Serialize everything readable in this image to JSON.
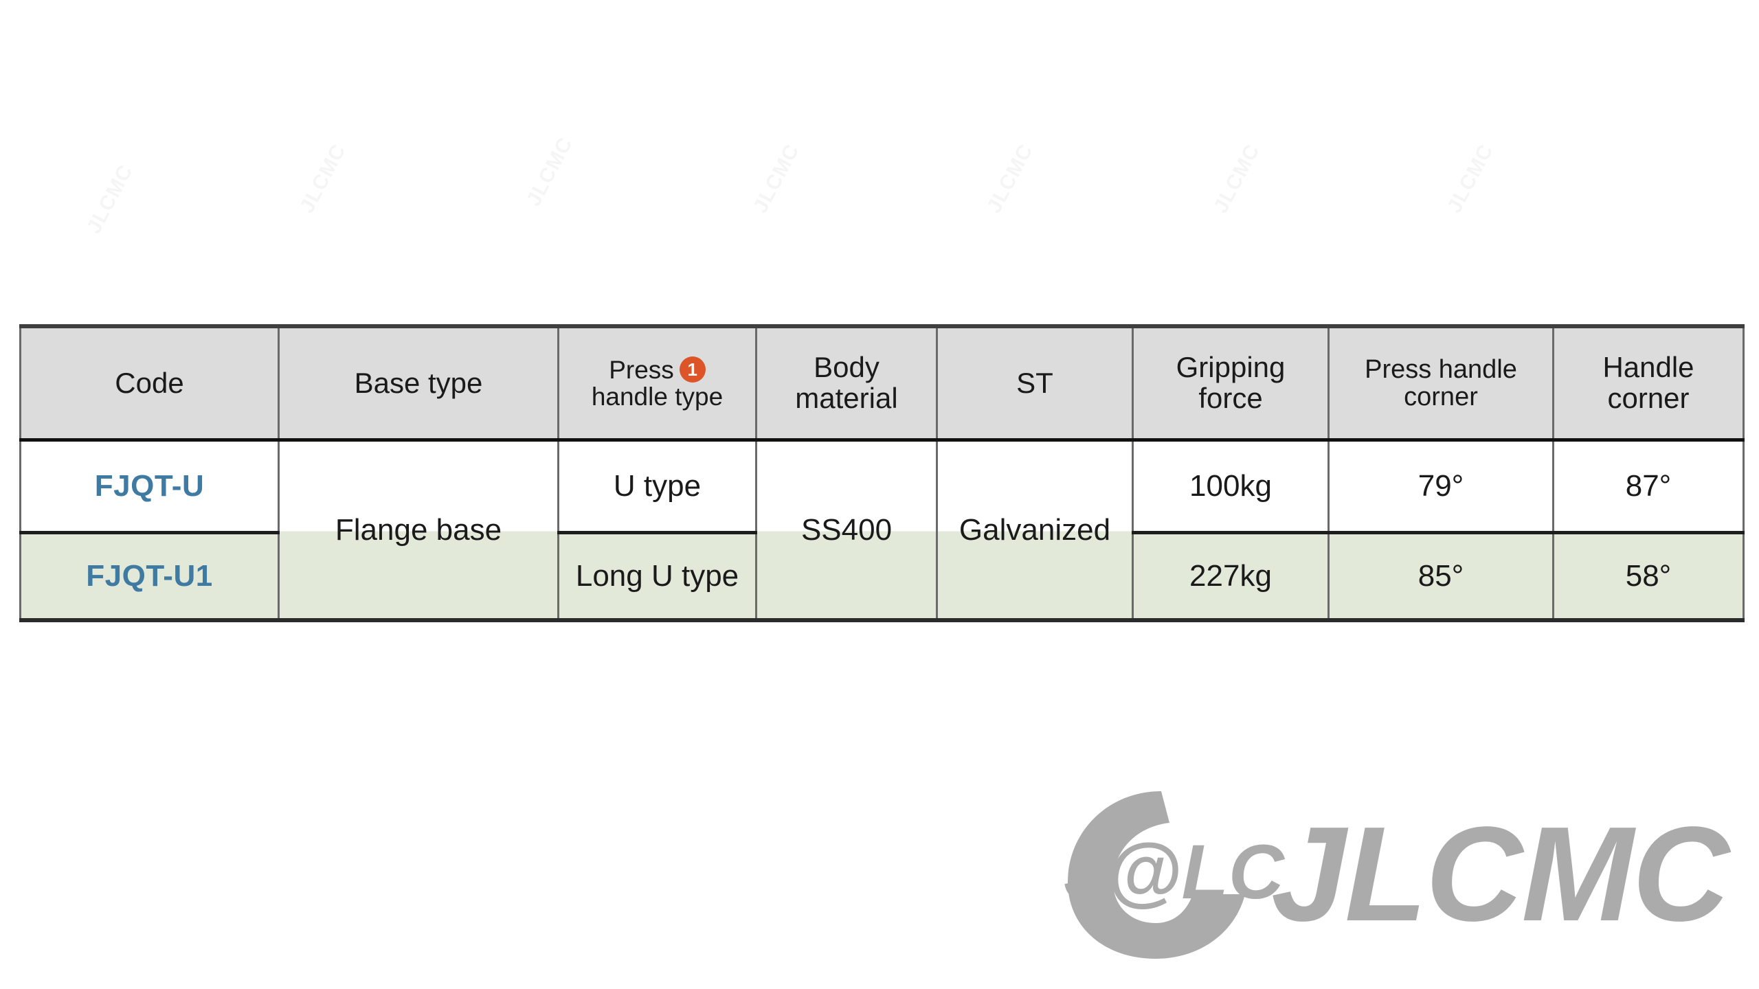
{
  "table": {
    "columns": [
      {
        "id": "code",
        "label": "Code"
      },
      {
        "id": "base_type",
        "label": "Base type"
      },
      {
        "id": "press_handle_type",
        "label_line1": "Press",
        "label_line2": "handle type",
        "note": "1",
        "note_color": "#dc5428"
      },
      {
        "id": "body_material",
        "label_line1": "Body",
        "label_line2": "material"
      },
      {
        "id": "st",
        "label": "ST"
      },
      {
        "id": "gripping_force",
        "label_line1": "Gripping",
        "label_line2": "force"
      },
      {
        "id": "press_handle_corner",
        "label_line1": "Press handle",
        "label_line2": "corner"
      },
      {
        "id": "handle_corner",
        "label_line1": "Handle",
        "label_line2": "corner"
      }
    ],
    "merged": {
      "base_type": "Flange base",
      "body_material": "SS400",
      "st": "Galvanized"
    },
    "rows": [
      {
        "code": "FJQT-U",
        "press_handle_type": "U type",
        "gripping_force": "100kg",
        "press_handle_corner": "79°",
        "handle_corner": "87°"
      },
      {
        "code": "FJQT-U1",
        "press_handle_type": "Long U type",
        "gripping_force": "227kg",
        "press_handle_corner": "85°",
        "handle_corner": "58°"
      }
    ]
  },
  "brand": {
    "mark_text": "J@LC",
    "wordmark": "JLCMC",
    "color": "#ababab"
  },
  "watermark": {
    "text": "JLCMC",
    "color": "#000000"
  },
  "theme": {
    "header_bg": "#dcdcdc",
    "row_a_bg": "#ffffff",
    "row_b_bg": "#e3e9d9",
    "code_color": "#3f7aa3",
    "border_color": "#6a6a6a",
    "heavy_border_color": "#1d1d1d",
    "badge_color": "#dc5428"
  }
}
